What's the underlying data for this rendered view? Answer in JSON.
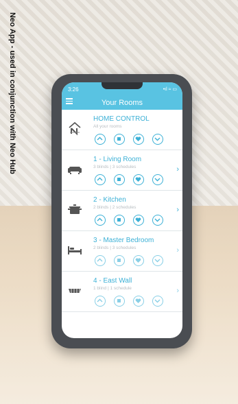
{
  "side_caption": "Neo App - used in conjunction with Neo Hub",
  "status": {
    "time": "3:26",
    "icons": "•ıl ≈ ▭"
  },
  "header": {
    "title": "Your Rooms"
  },
  "rooms": [
    {
      "name": "HOME CONTROL",
      "subtitle": "All your rooms",
      "icon": "house-logo-icon"
    },
    {
      "name": "1 - Living Room",
      "subtitle": "3 blinds | 3 schedules",
      "icon": "sofa-icon"
    },
    {
      "name": "2 - Kitchen",
      "subtitle": "2 blinds | 2 schedules",
      "icon": "cooking-pot-icon"
    },
    {
      "name": "3 - Master Bedroom",
      "subtitle": "2 blinds | 3 schedules",
      "icon": "bed-icon"
    },
    {
      "name": "4 - East Wall",
      "subtitle": "1 blind | 1 schedule",
      "icon": "blind-shade-icon"
    }
  ],
  "controls": [
    "up-icon",
    "stop-icon",
    "favourite-icon",
    "down-icon"
  ],
  "colors": {
    "accent": "#3bb0d6",
    "header": "#59c3e2"
  }
}
